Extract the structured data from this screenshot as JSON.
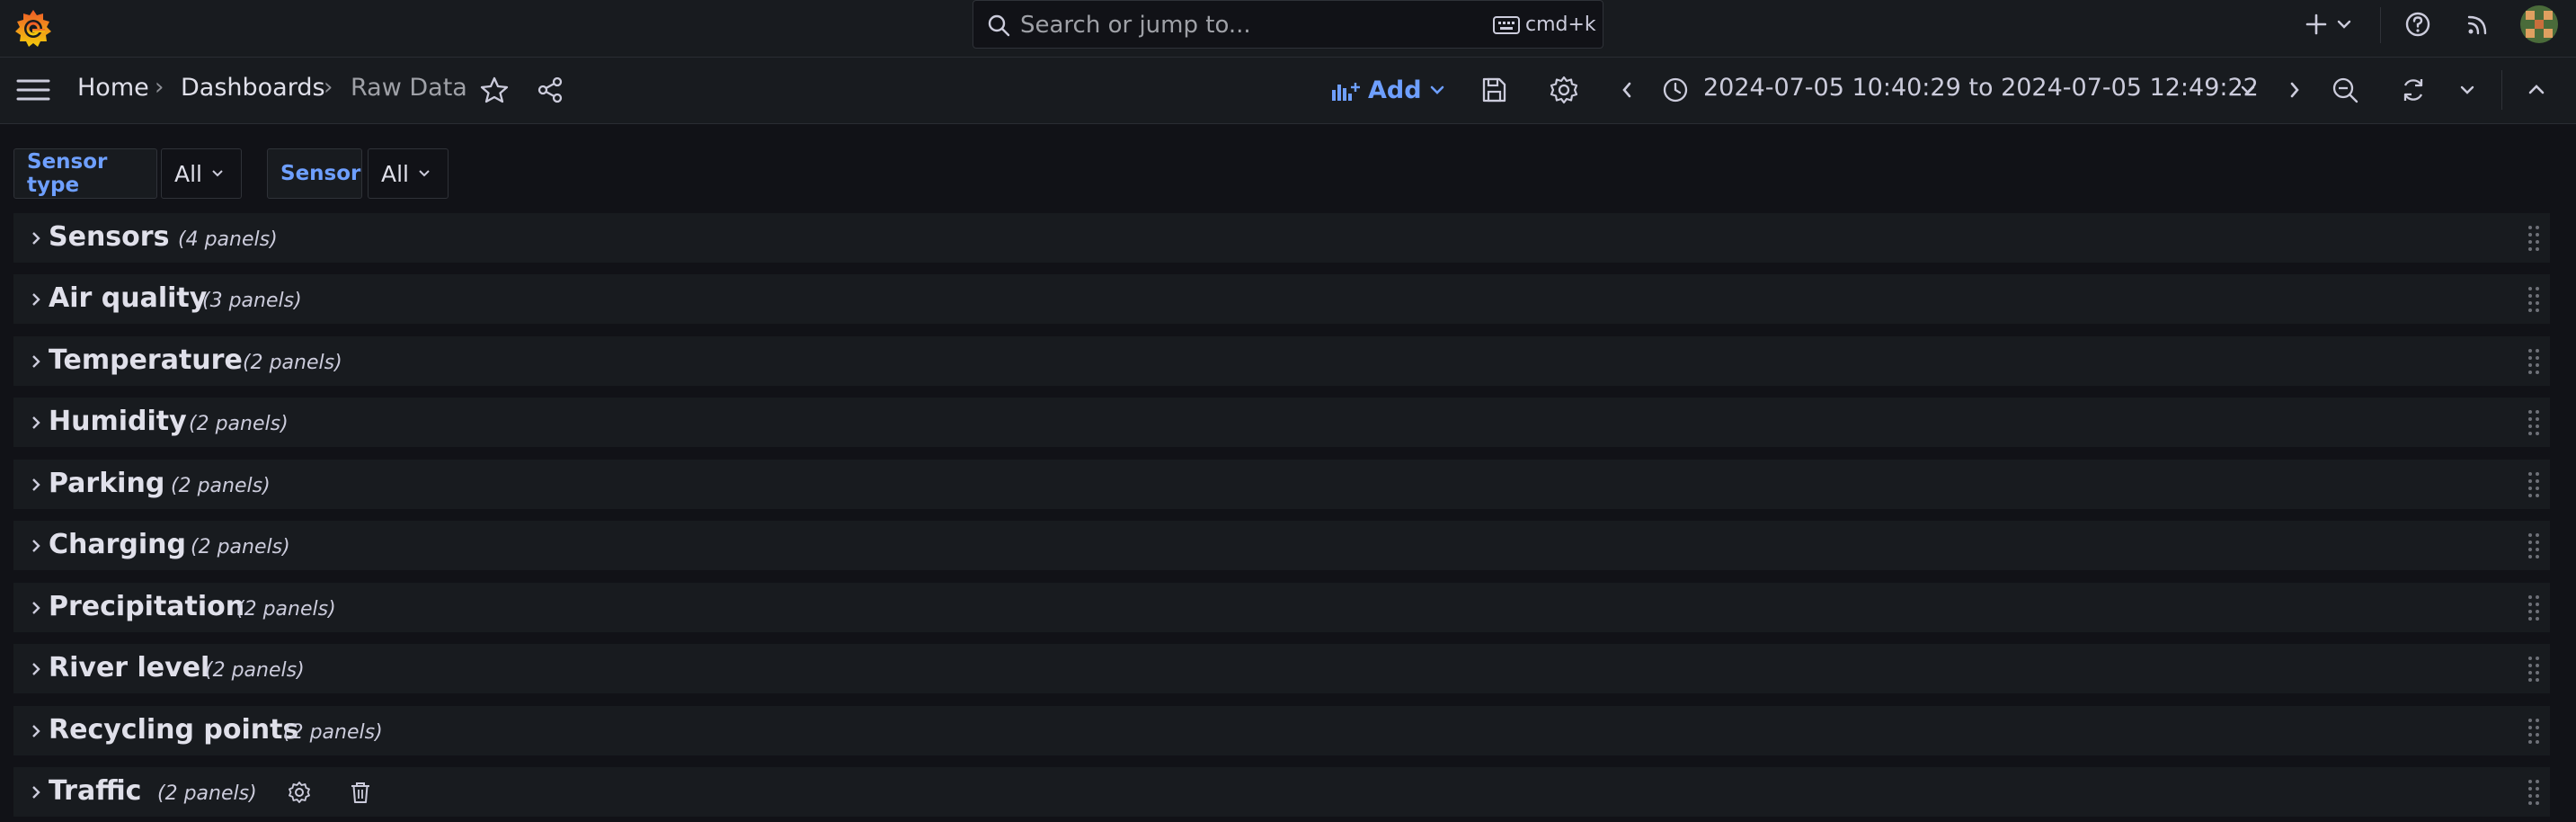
{
  "topbar": {
    "search_placeholder": "Search or jump to...",
    "search_shortcut": "cmd+k"
  },
  "breadcrumb": {
    "home": "Home",
    "dashboards": "Dashboards",
    "current": "Raw Data"
  },
  "toolbar": {
    "add_label": "Add",
    "time_from": "2024-07-05 10:40:29",
    "time_to_word": "to",
    "time_to": "2024-07-05 12:49:22"
  },
  "variables": [
    {
      "label": "Sensor type",
      "value": "All"
    },
    {
      "label": "Sensor",
      "value": "All"
    }
  ],
  "rows": [
    {
      "title": "Sensors",
      "count": "(4 panels)"
    },
    {
      "title": "Air quality",
      "count": "(3 panels)"
    },
    {
      "title": "Temperature",
      "count": "(2 panels)"
    },
    {
      "title": "Humidity",
      "count": "(2 panels)"
    },
    {
      "title": "Parking",
      "count": "(2 panels)"
    },
    {
      "title": "Charging",
      "count": "(2 panels)"
    },
    {
      "title": "Precipitation",
      "count": "(2 panels)"
    },
    {
      "title": "River level",
      "count": "(2 panels)"
    },
    {
      "title": "Recycling points",
      "count": "(2 panels)"
    },
    {
      "title": "Traffic",
      "count": "(2 panels)"
    }
  ],
  "colors": {
    "accent": "#6e9fff",
    "background": "#111217",
    "panel": "#181b1f"
  }
}
